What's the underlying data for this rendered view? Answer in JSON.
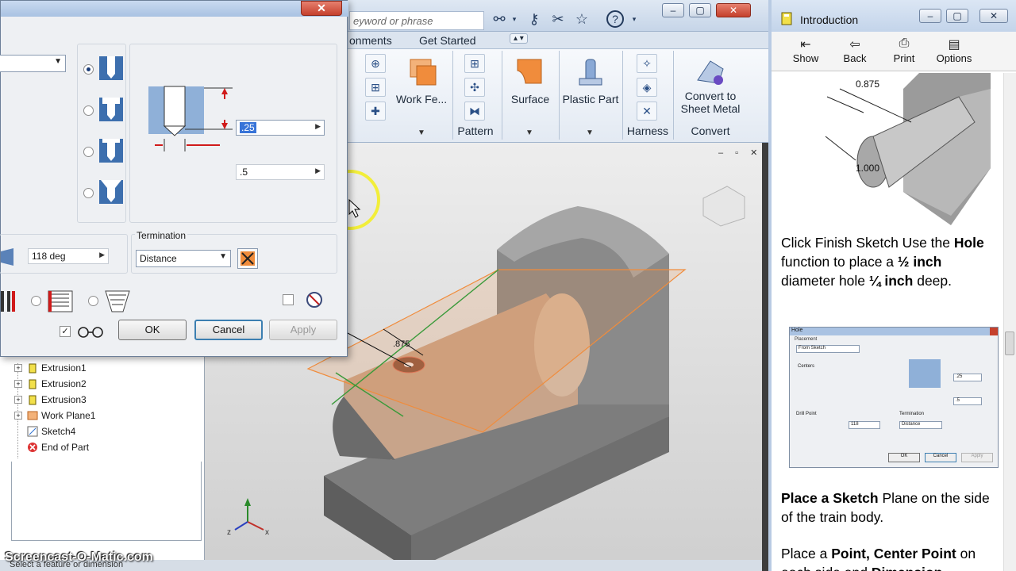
{
  "app": {
    "search_placeholder": "eyword or phrase",
    "ribbon_tabs": [
      "onments",
      "Get Started"
    ],
    "ribbon": {
      "work_features": "Work Fe...",
      "pattern_panel": "Pattern",
      "surface": "Surface",
      "plastic_part": "Plastic Part",
      "harness_panel": "Harness",
      "convert_line1": "Convert to",
      "convert_line2": "Sheet Metal",
      "convert_panel": "Convert"
    },
    "model_dimension": ".875",
    "tree_items": [
      "Extrusion1",
      "Extrusion2",
      "Extrusion3",
      "Work Plane1",
      "Sketch4",
      "End of Part"
    ],
    "status_text": "Select a feature or dimension",
    "watermark": "Screencast-O-Matic.com",
    "colors": {
      "ribbon_bg": "#e3eaf3",
      "accent_orange": "#f08c3c",
      "viewport_bg": "#d9d9d9"
    }
  },
  "dialog": {
    "depth_value": ".25",
    "diameter_value": ".5",
    "drill_point_angle": "118 deg",
    "termination_label": "Termination",
    "termination_value": "Distance",
    "ok_label": "OK",
    "cancel_label": "Cancel",
    "apply_label": "Apply"
  },
  "help": {
    "window_title": "Introduction",
    "toolbar": [
      "Show",
      "Back",
      "Print",
      "Options"
    ],
    "figure1_dim_top": "0.875",
    "figure1_dim_side": "1.000",
    "para1_a": "Click Finish Sketch Use the ",
    "para1_b": "Hole",
    "para1_c": " function to place a ",
    "para1_d": "½ inch",
    "para1_e": " diameter hole ",
    "para1_f": "¼ inch",
    "para1_g": " deep.",
    "mini_dialog": {
      "title": "Hole",
      "placement": "Placement",
      "from_sketch": "From Sketch",
      "centers": "Centers",
      "val1": ".25",
      "val2": ".5",
      "drill_point": "Drill Point",
      "angle": "118",
      "termination": "Termination",
      "distance": "Distance",
      "ok": "OK",
      "cancel": "Cancel",
      "apply": "Apply"
    },
    "para2_a": "Place a Sketch",
    "para2_b": " Plane on the side of the train body.",
    "para3_a": "Place a ",
    "para3_b": "Point, Center Point",
    "para3_c": " on each side and ",
    "para3_d": "Dimension"
  }
}
